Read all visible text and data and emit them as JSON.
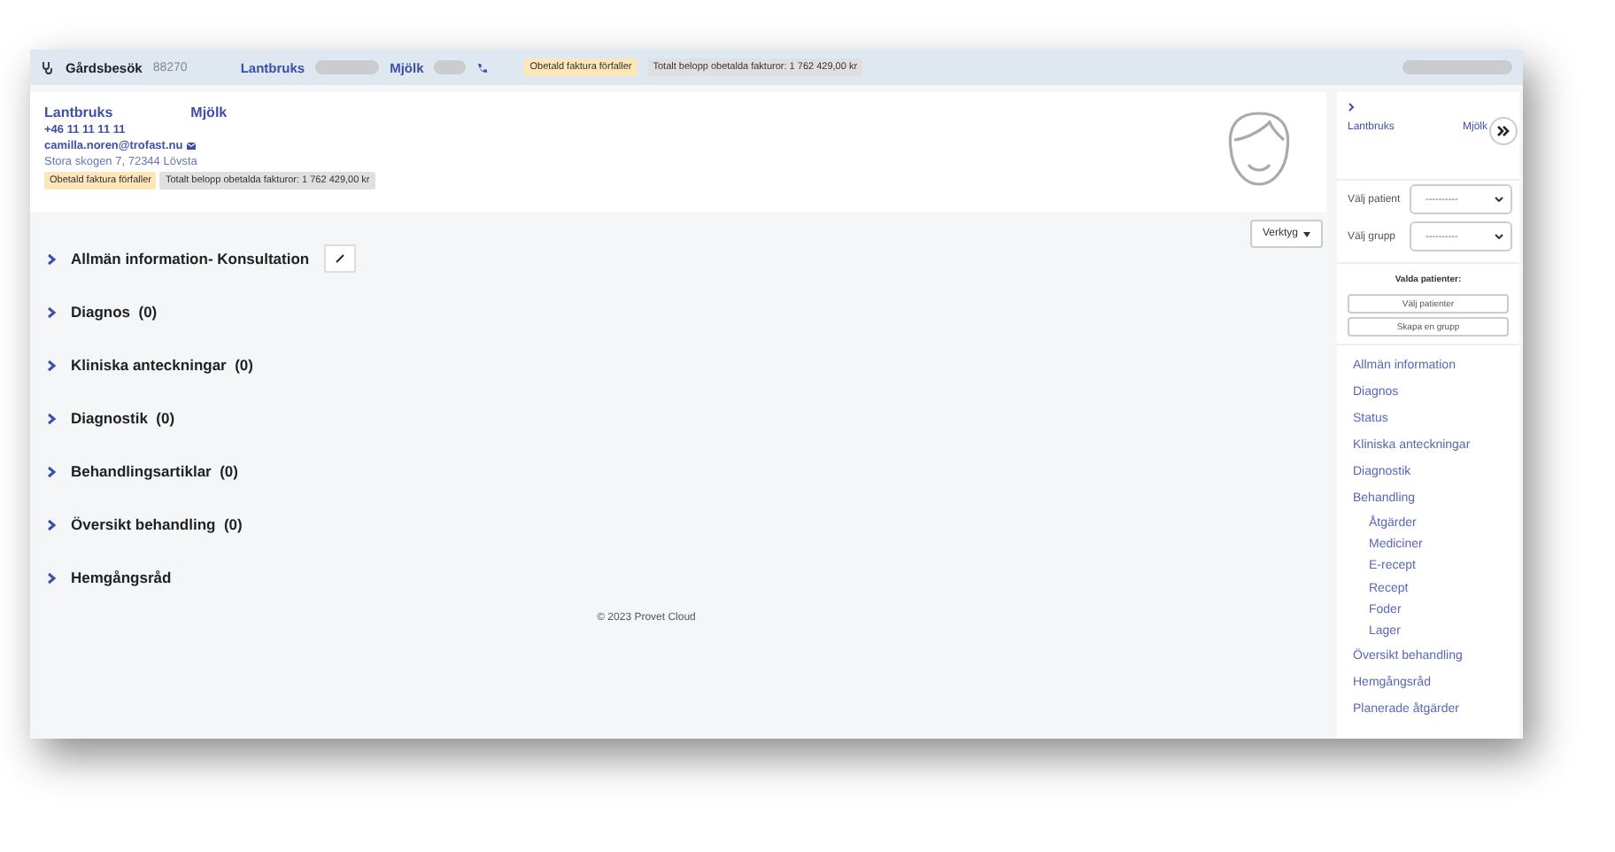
{
  "top_bar": {
    "title": "Gårdsbesök",
    "number": "88270",
    "owner_first": "Lantbruks",
    "owner_second": "Mjölk",
    "badges": [
      {
        "kind": "warning",
        "text": "Obetald faktura förfaller"
      },
      {
        "kind": "neutral",
        "text": "Totalt belopp obetalda fakturor: 1 762 429,00 kr"
      }
    ]
  },
  "client": {
    "first_name": "Lantbruks",
    "last_name": "Mjölk",
    "phone": "+46 11 11 11 11",
    "email": "camilla.noren@trofast.nu",
    "address": "Stora skogen 7, 72344 Lövsta",
    "badges": [
      {
        "kind": "warning",
        "text": "Obetald faktura förfaller"
      },
      {
        "kind": "neutral",
        "text": "Totalt belopp obetalda fakturor: 1 762 429,00 kr"
      }
    ]
  },
  "tools_button": "Verktyg",
  "sections": [
    {
      "title": "Allmän information- Konsultation",
      "editable": true
    },
    {
      "title": "Diagnos",
      "count": "(0)",
      "editable": false
    },
    {
      "title": "Kliniska anteckningar",
      "count": "(0)",
      "editable": false
    },
    {
      "title": "Diagnostik",
      "count": "(0)",
      "editable": false
    },
    {
      "title": "Behandlingsartiklar",
      "count": "(0)",
      "editable": false
    },
    {
      "title": "Översikt behandling",
      "count": "(0)",
      "editable": false
    },
    {
      "title": "Hemgångsråd",
      "editable": false
    }
  ],
  "footer": "© 2023 Provet Cloud",
  "sidebar": {
    "owner_first": "Lantbruks",
    "owner_second": "Mjölk",
    "patient_label": "Välj patient",
    "patient_value": "----------",
    "group_label": "Välj grupp",
    "group_value": "----------",
    "selected_heading": "Valda patienter:",
    "buttons": [
      "Välj patienter",
      "Skapa en grupp"
    ],
    "nav": [
      {
        "label": "Allmän information"
      },
      {
        "label": "Diagnos"
      },
      {
        "label": "Status"
      },
      {
        "label": "Kliniska anteckningar"
      },
      {
        "label": "Diagnostik"
      },
      {
        "label": "Behandling",
        "children": [
          {
            "label": "Åtgärder"
          },
          {
            "label": "Mediciner"
          },
          {
            "label": "E-recept"
          },
          {
            "label": "Recept"
          },
          {
            "label": "Foder"
          },
          {
            "label": "Lager"
          }
        ]
      },
      {
        "label": "Översikt behandling"
      },
      {
        "label": "Hemgångsråd"
      },
      {
        "label": "Planerade åtgärder"
      }
    ]
  }
}
